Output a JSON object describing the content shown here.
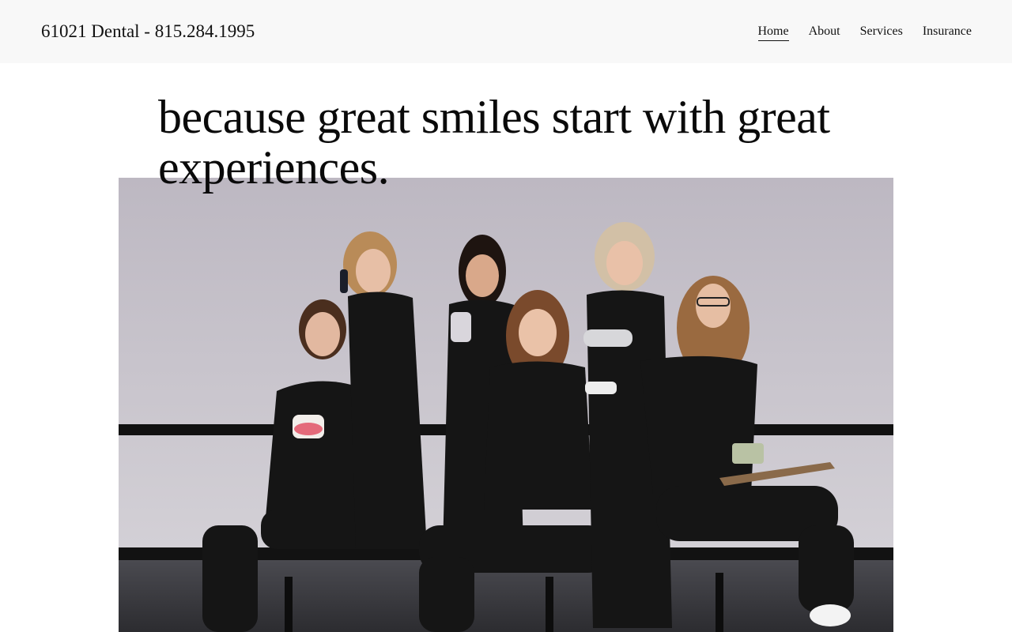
{
  "site": {
    "title": "61021 Dental - 815.284.1995"
  },
  "nav": {
    "items": [
      {
        "label": "Home",
        "active": true
      },
      {
        "label": "About",
        "active": false
      },
      {
        "label": "Services",
        "active": false
      },
      {
        "label": "Insurance",
        "active": false
      }
    ]
  },
  "hero": {
    "headline": "because great smiles start with great experiences.",
    "photo_subject": "team-photo"
  },
  "colors": {
    "header_bg": "#f8f8f8",
    "text": "#111111",
    "wall": "#c7c4cc",
    "scrubs": "#151515",
    "floor": "#3a3a3e"
  }
}
